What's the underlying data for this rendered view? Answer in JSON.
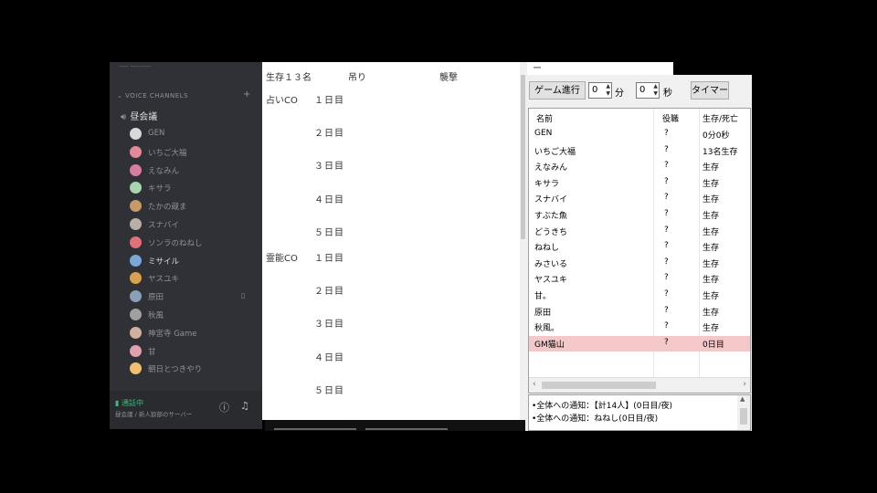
{
  "sidebar": {
    "top_text": "---- ---------",
    "category": "VOICE CHANNELS",
    "category_plus": "+",
    "channel": "昼会議",
    "members": [
      {
        "name": "GEN",
        "color": "#d9d9d9",
        "bright": false,
        "mark": ""
      },
      {
        "name": "いちご大福",
        "color": "#e08a9a",
        "bright": false,
        "mark": ""
      },
      {
        "name": "えなみん",
        "color": "#d67ea0",
        "bright": false,
        "mark": ""
      },
      {
        "name": "キサラ",
        "color": "#a9d4b0",
        "bright": false,
        "mark": ""
      },
      {
        "name": "たかの蔵ま",
        "color": "#c89a6a",
        "bright": false,
        "mark": ""
      },
      {
        "name": "スナバイ",
        "color": "#b8b0a8",
        "bright": false,
        "mark": ""
      },
      {
        "name": "ソンラのねねし",
        "color": "#e0707a",
        "bright": false,
        "mark": ""
      },
      {
        "name": "ミサイル",
        "color": "#7aa6d8",
        "bright": true,
        "mark": ""
      },
      {
        "name": "ヤスユキ",
        "color": "#d8a050",
        "bright": false,
        "mark": ""
      },
      {
        "name": "原田",
        "color": "#8aa0b8",
        "bright": false,
        "mark": "▯"
      },
      {
        "name": "秋風",
        "color": "#a0a0a0",
        "bright": false,
        "mark": ""
      },
      {
        "name": "神宮寺 Game",
        "color": "#d0b0a0",
        "bright": false,
        "mark": ""
      },
      {
        "name": "甘",
        "color": "#e0a0b0",
        "bright": false,
        "mark": ""
      },
      {
        "name": "朝日とつきやり",
        "color": "#f0c070",
        "bright": false,
        "mark": ""
      }
    ],
    "status": {
      "connected": "通話中",
      "sub": "昼会議 / 新人狼部のサーバー",
      "icon_info": "ⓘ",
      "icon_music": "♫"
    }
  },
  "sheet": {
    "header": {
      "alive": "生存１３名",
      "hang": "吊り",
      "attack": "襲撃"
    },
    "groups": [
      {
        "label": "占いCO",
        "days": [
          "１日目",
          "２日目",
          "３日目",
          "４日目",
          "５日目"
        ]
      },
      {
        "label": "霊能CO",
        "days": [
          "１日目",
          "２日目",
          "３日目",
          "４日目",
          "５日目"
        ]
      }
    ],
    "top_right": "ー"
  },
  "gm": {
    "progress_button": "ゲーム進行",
    "minutes_value": "0",
    "minutes_unit": "分",
    "seconds_value": "0",
    "seconds_unit": "秒",
    "timer_button": "タイマー",
    "columns": {
      "name": "名前",
      "role": "役職",
      "state": "生存/死亡"
    },
    "rows": [
      {
        "name": "GEN",
        "role": "?",
        "state": "0分0秒"
      },
      {
        "name": "いちご大福",
        "role": "?",
        "state": "13名生存"
      },
      {
        "name": "えなみん",
        "role": "?",
        "state": "生存"
      },
      {
        "name": "キサラ",
        "role": "?",
        "state": "生存"
      },
      {
        "name": "スナバイ",
        "role": "?",
        "state": "生存"
      },
      {
        "name": "すぶた魚",
        "role": "?",
        "state": "生存"
      },
      {
        "name": "どうきち",
        "role": "?",
        "state": "生存"
      },
      {
        "name": "ねねし",
        "role": "?",
        "state": "生存"
      },
      {
        "name": "みさいる",
        "role": "?",
        "state": "生存"
      },
      {
        "name": "ヤスユキ",
        "role": "?",
        "state": "生存"
      },
      {
        "name": "甘。",
        "role": "?",
        "state": "生存"
      },
      {
        "name": "原田",
        "role": "?",
        "state": "生存"
      },
      {
        "name": "秋風。",
        "role": "?",
        "state": "生存"
      },
      {
        "name": "GM猫山",
        "role": "?",
        "state": "0日目",
        "highlight": true
      }
    ],
    "log": [
      "•全体への通知：【計14人】(0日目/夜)",
      "•全体への通知：ねねし(0日目/夜)"
    ]
  }
}
